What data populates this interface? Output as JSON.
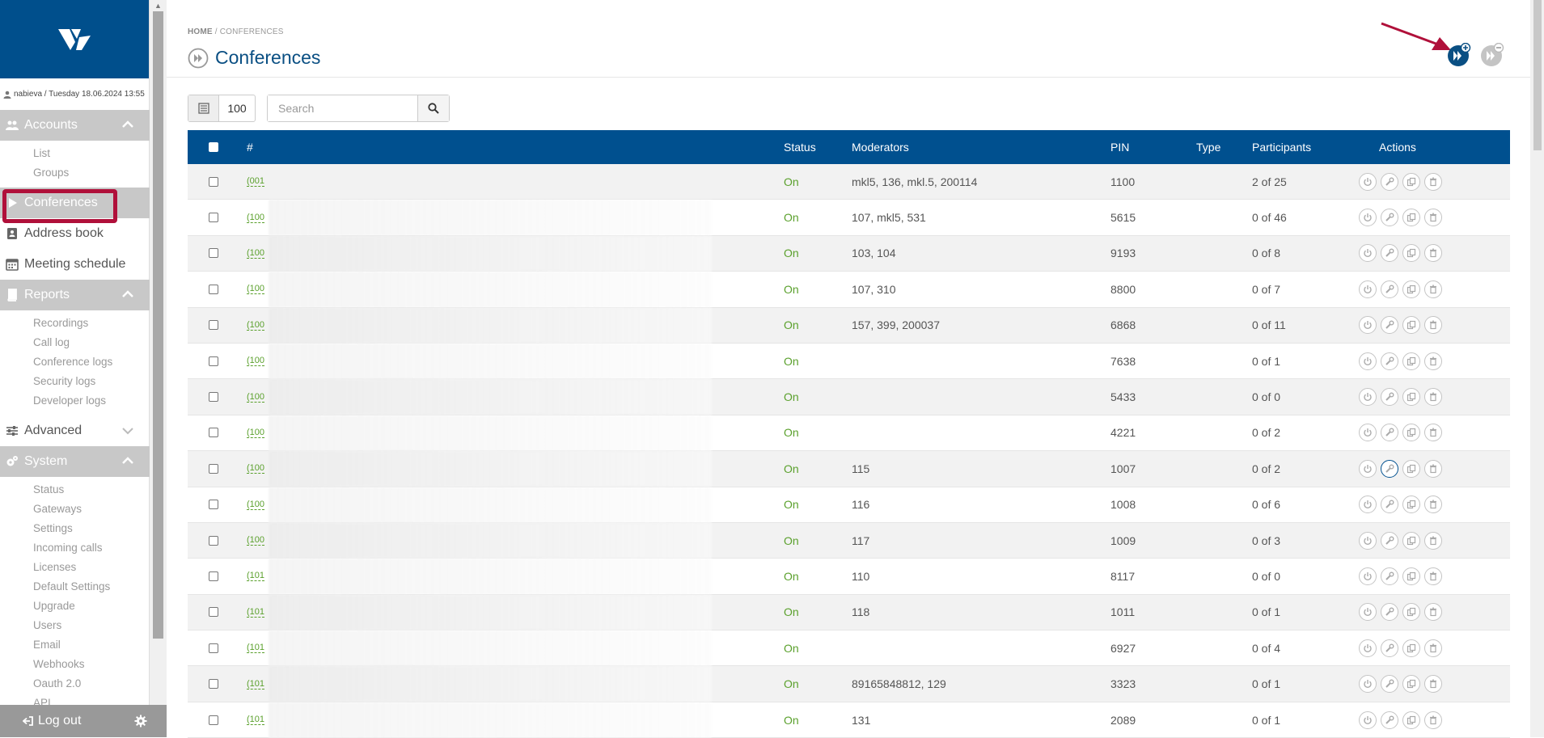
{
  "sidebar": {
    "user_line": "nabieva / Tuesday 18.06.2024 13:55",
    "sections": {
      "accounts": {
        "label": "Accounts",
        "items": [
          "List",
          "Groups"
        ]
      },
      "conferences": {
        "label": "Conferences"
      },
      "address_book": {
        "label": "Address book"
      },
      "meeting_schedule": {
        "label": "Meeting schedule"
      },
      "reports": {
        "label": "Reports",
        "items": [
          "Recordings",
          "Call log",
          "Conference logs",
          "Security logs",
          "Developer logs"
        ]
      },
      "advanced": {
        "label": "Advanced"
      },
      "system": {
        "label": "System",
        "items": [
          "Status",
          "Gateways",
          "Settings",
          "Incoming calls",
          "Licenses",
          "Default Settings",
          "Upgrade",
          "Users",
          "Email",
          "Webhooks",
          "Oauth 2.0",
          "API"
        ]
      }
    },
    "logout_label": "Log out"
  },
  "breadcrumb": {
    "home": "HOME",
    "sep": " / ",
    "current": "CONFERENCES"
  },
  "page_title": "Conferences",
  "toolbar": {
    "page_length": "100",
    "search_placeholder": "Search"
  },
  "table": {
    "headers": {
      "num": "#",
      "status": "Status",
      "moderators": "Moderators",
      "pin": "PIN",
      "type": "Type",
      "participants": "Participants",
      "actions": "Actions"
    },
    "rows": [
      {
        "num": "(001",
        "status": "On",
        "moderators": "mkl5, 136, mkl.5, 200114",
        "pin": "1100",
        "participants": "2 of 25"
      },
      {
        "num": "(100",
        "status": "On",
        "moderators": "107, mkl5, 531",
        "pin": "5615",
        "participants": "0 of 46"
      },
      {
        "num": "(100",
        "status": "On",
        "moderators": "103, 104",
        "pin": "9193",
        "participants": "0 of 8"
      },
      {
        "num": "(100",
        "status": "On",
        "moderators": "107, 310",
        "pin": "8800",
        "participants": "0 of 7"
      },
      {
        "num": "(100",
        "status": "On",
        "moderators": "157, 399, 200037",
        "pin": "6868",
        "participants": "0 of 11"
      },
      {
        "num": "(100",
        "status": "On",
        "moderators": "",
        "pin": "7638",
        "participants": "0 of 1"
      },
      {
        "num": "(100",
        "status": "On",
        "moderators": "",
        "pin": "5433",
        "participants": "0 of 0"
      },
      {
        "num": "(100",
        "status": "On",
        "moderators": "",
        "pin": "4221",
        "participants": "0 of 2"
      },
      {
        "num": "(100",
        "status": "On",
        "moderators": "115",
        "pin": "1007",
        "participants": "0 of 2"
      },
      {
        "num": "(100",
        "status": "On",
        "moderators": "116",
        "pin": "1008",
        "participants": "0 of 6"
      },
      {
        "num": "(100",
        "status": "On",
        "moderators": "117",
        "pin": "1009",
        "participants": "0 of 3"
      },
      {
        "num": "(101",
        "status": "On",
        "moderators": "110",
        "pin": "8117",
        "participants": "0 of 0"
      },
      {
        "num": "(101",
        "status": "On",
        "moderators": "118",
        "pin": "1011",
        "participants": "0 of 1"
      },
      {
        "num": "(101",
        "status": "On",
        "moderators": "",
        "pin": "6927",
        "participants": "0 of 4"
      },
      {
        "num": "(101",
        "status": "On",
        "moderators": "89165848812, 129",
        "pin": "3323",
        "participants": "0 of 1"
      },
      {
        "num": "(101",
        "status": "On",
        "moderators": "131",
        "pin": "2089",
        "participants": "0 of 1"
      }
    ]
  },
  "colors": {
    "brand": "#004f8c",
    "status_on": "#5aa02c",
    "annotation": "#b0103a"
  },
  "icons": [
    "user-icon",
    "users-icon",
    "play-icon",
    "address-book-icon",
    "calendar-icon",
    "book-icon",
    "sliders-icon",
    "cogs-icon",
    "logout-icon",
    "gear-icon",
    "list-icon",
    "search-icon",
    "power-icon",
    "wrench-icon",
    "copy-icon",
    "trash-icon",
    "add-conference-icon",
    "remove-conference-icon"
  ]
}
